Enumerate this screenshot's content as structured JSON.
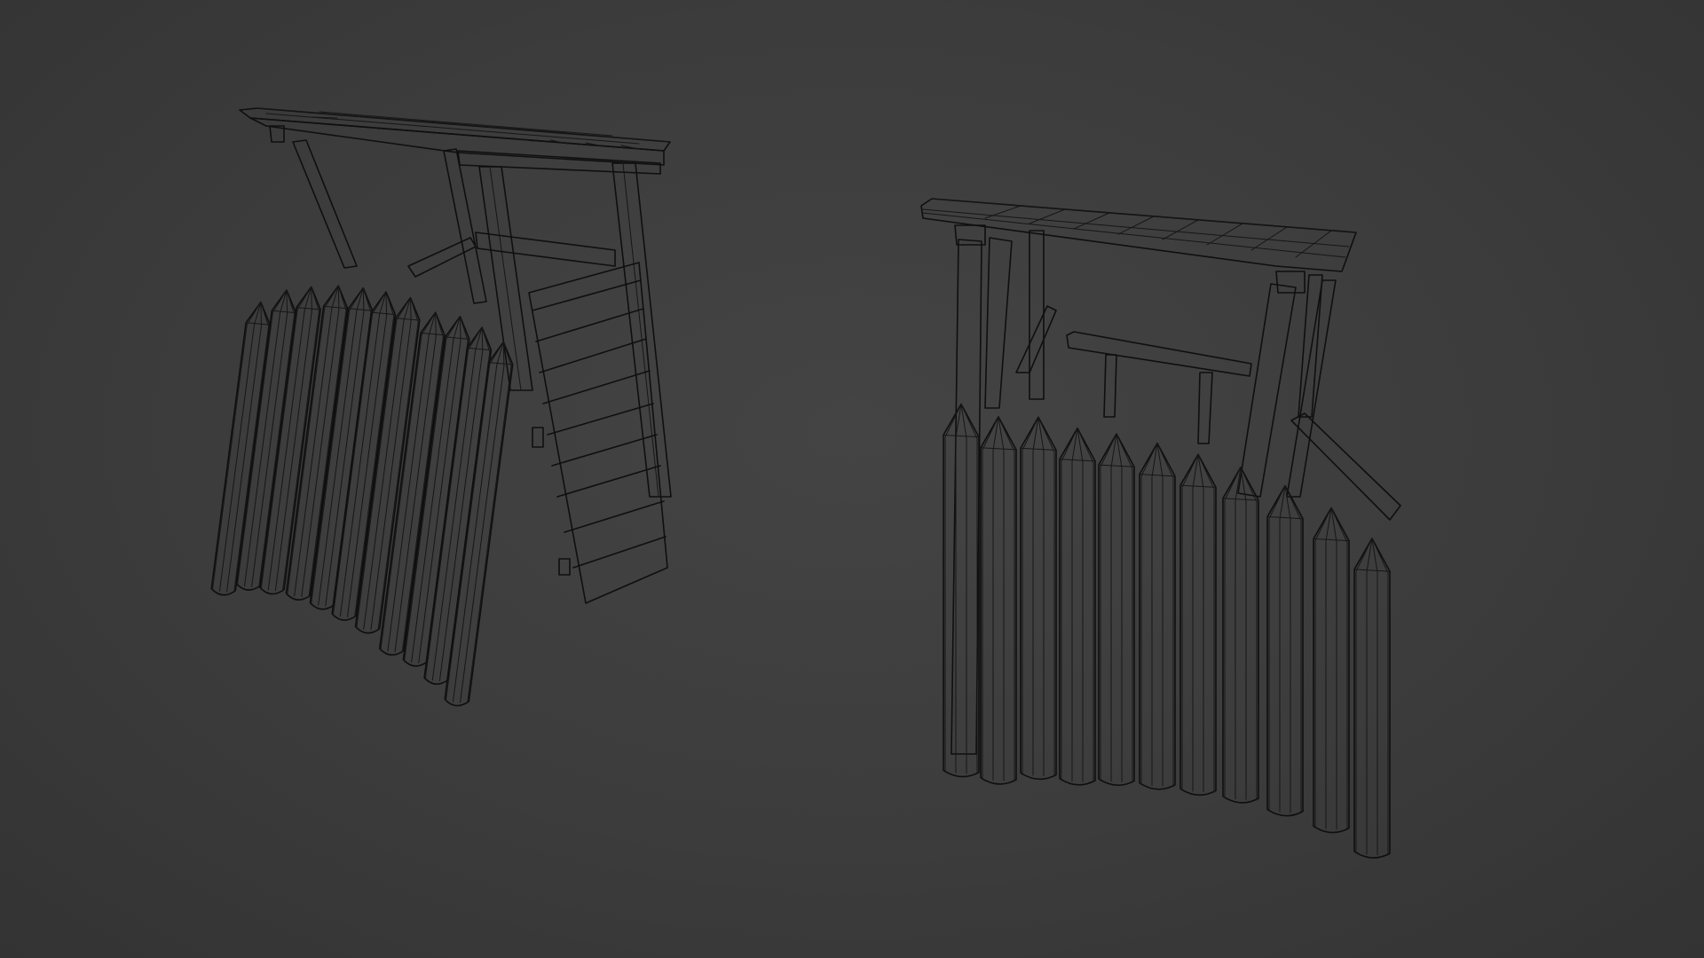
{
  "viewport": {
    "background": "#3d3d3d",
    "wire_color": "#0f0f0f",
    "shading": "wireframe"
  },
  "objects": [
    {
      "kind": "watchtower-palisade-model",
      "variant": "front-left"
    },
    {
      "kind": "watchtower-palisade-model",
      "variant": "front-right"
    }
  ]
}
